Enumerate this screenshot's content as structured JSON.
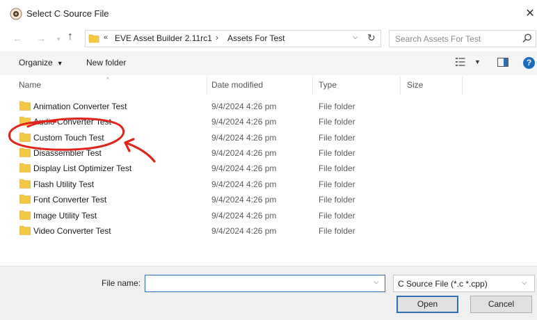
{
  "window": {
    "title": "Select C Source File",
    "close_symbol": "✕"
  },
  "address": {
    "overflow_symbol": "«",
    "breadcrumbs": [
      "EVE Asset Builder 2.11rc1",
      "Assets For Test"
    ],
    "separator": "›"
  },
  "search": {
    "placeholder": "Search Assets For Test"
  },
  "toolbar": {
    "organize_label": "Organize",
    "new_folder_label": "New folder",
    "help_symbol": "?"
  },
  "columns": {
    "name": "Name",
    "date": "Date modified",
    "type": "Type",
    "size": "Size"
  },
  "files": [
    {
      "name": "Animation Converter Test",
      "date": "9/4/2024 4:26 pm",
      "type": "File folder"
    },
    {
      "name": "Audio Converter Test",
      "date": "9/4/2024 4:26 pm",
      "type": "File folder"
    },
    {
      "name": "Custom Touch Test",
      "date": "9/4/2024 4:26 pm",
      "type": "File folder"
    },
    {
      "name": "Disassembler Test",
      "date": "9/4/2024 4:26 pm",
      "type": "File folder"
    },
    {
      "name": "Display List Optimizer Test",
      "date": "9/4/2024 4:26 pm",
      "type": "File folder"
    },
    {
      "name": "Flash Utility Test",
      "date": "9/4/2024 4:26 pm",
      "type": "File folder"
    },
    {
      "name": "Font Converter Test",
      "date": "9/4/2024 4:26 pm",
      "type": "File folder"
    },
    {
      "name": "Image Utility Test",
      "date": "9/4/2024 4:26 pm",
      "type": "File folder"
    },
    {
      "name": "Video Converter Test",
      "date": "9/4/2024 4:26 pm",
      "type": "File folder"
    }
  ],
  "bottom": {
    "filename_label": "File name:",
    "filename_value": "",
    "filetype_value": "C Source File (*.c *.cpp)",
    "open_label": "Open",
    "cancel_label": "Cancel"
  },
  "icons": {
    "app": "app-icon",
    "folder": "folder-icon",
    "back": "arrow-left-icon",
    "forward": "arrow-right-icon",
    "up": "arrow-up-icon",
    "refresh": "refresh-icon",
    "search": "search-icon",
    "view": "view-options-icon",
    "preview": "preview-pane-icon",
    "help": "help-icon"
  },
  "colors": {
    "accent": "#2a6fb8",
    "folder": "#f5c842",
    "annotation": "#e0241b"
  },
  "annotation": {
    "circled_item": "Custom Touch Test"
  }
}
